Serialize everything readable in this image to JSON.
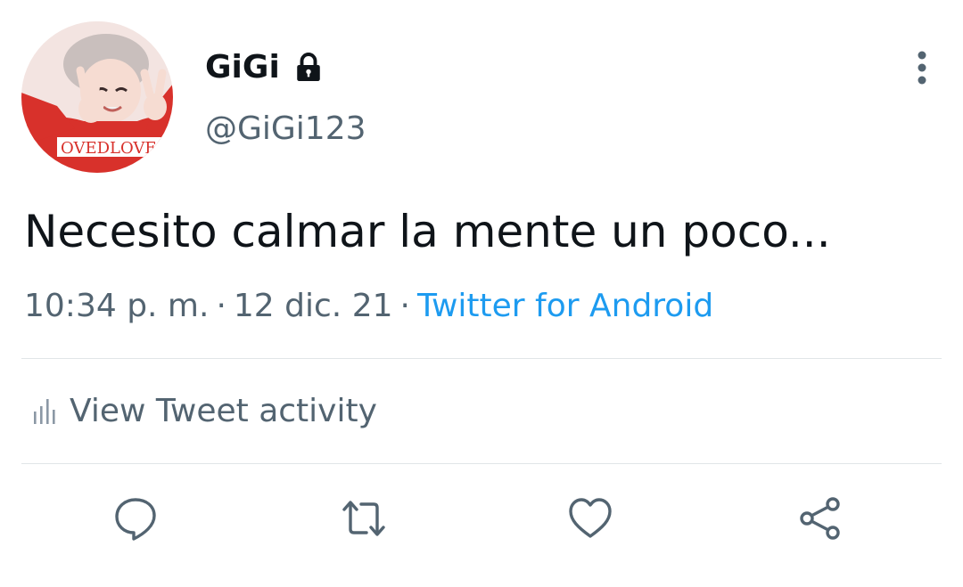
{
  "user": {
    "display_name": "GiGi",
    "handle": "@GiGi123",
    "protected_icon": "lock-icon",
    "avatar_text": "OVEDLOVE"
  },
  "tweet": {
    "text": "Necesito calmar la mente un poco...",
    "time": "10:34 p. m.",
    "date": "12 dic. 21",
    "separator": "·",
    "source": "Twitter for Android"
  },
  "activity": {
    "label": "View Tweet activity",
    "icon": "bar-chart-icon"
  },
  "actions": [
    {
      "name": "reply",
      "icon": "reply-icon"
    },
    {
      "name": "retweet",
      "icon": "retweet-icon"
    },
    {
      "name": "like",
      "icon": "heart-icon"
    },
    {
      "name": "share",
      "icon": "share-icon"
    }
  ],
  "colors": {
    "text": "#0f1419",
    "secondary": "#536471",
    "link": "#1d9bf0",
    "divider": "#e1e5e8"
  }
}
